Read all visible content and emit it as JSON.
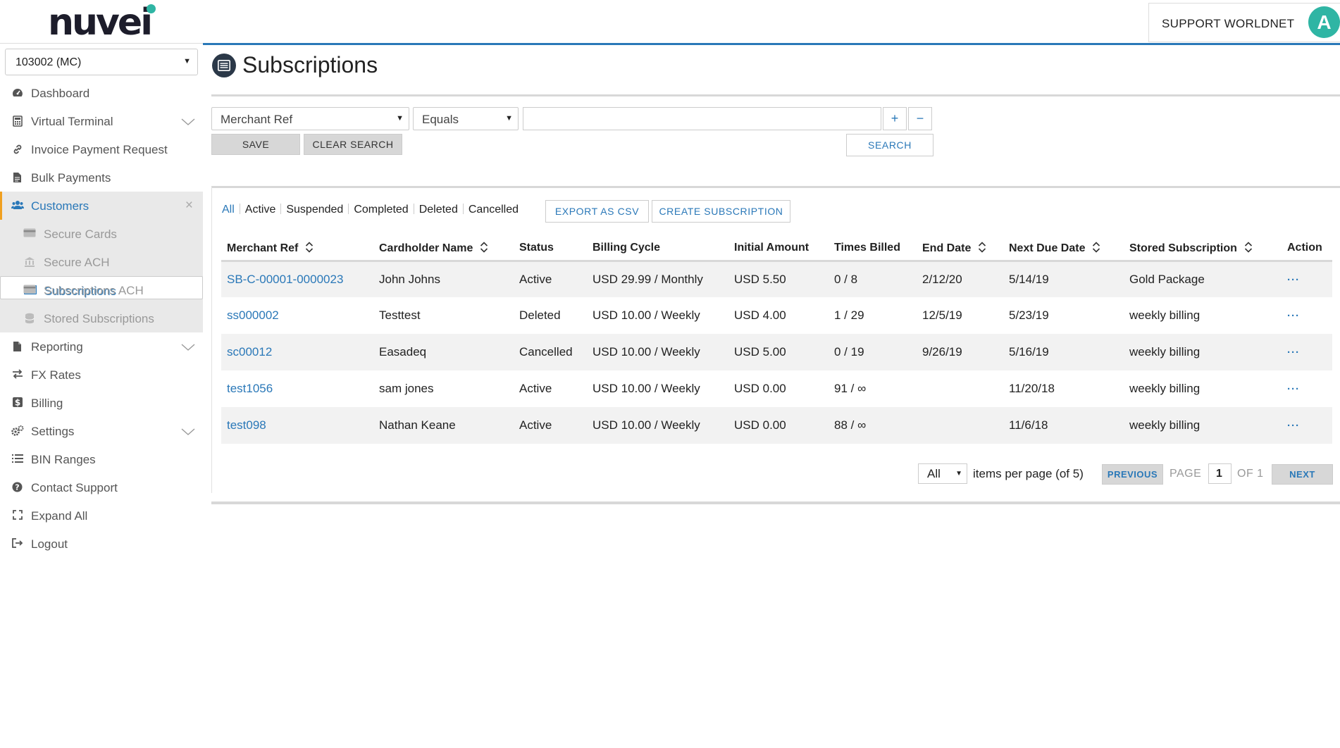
{
  "brand": {
    "logo_text": "nuvei",
    "accent": "#2fb5a4",
    "primary": "#2a78b8"
  },
  "user": {
    "name": "SUPPORT WORLDNET",
    "initial": "A"
  },
  "account_select": {
    "value": "103002 (MC)"
  },
  "sidebar": {
    "items": [
      {
        "label": "Dashboard",
        "icon": "gauge-icon"
      },
      {
        "label": "Virtual Terminal",
        "icon": "calculator-icon"
      },
      {
        "label": "Invoice Payment Request",
        "icon": "link-icon"
      },
      {
        "label": "Bulk Payments",
        "icon": "document-icon"
      },
      {
        "label": "Customers",
        "icon": "users-icon"
      },
      {
        "label": "Reporting",
        "icon": "file-icon"
      },
      {
        "label": "FX Rates",
        "icon": "exchange-icon"
      },
      {
        "label": "Billing",
        "icon": "dollar-icon"
      },
      {
        "label": "Settings",
        "icon": "gears-icon"
      },
      {
        "label": "BIN Ranges",
        "icon": "list-icon"
      },
      {
        "label": "Contact Support",
        "icon": "question-icon"
      },
      {
        "label": "Expand All",
        "icon": "expand-icon"
      },
      {
        "label": "Logout",
        "icon": "logout-icon"
      }
    ],
    "customers_sub": [
      {
        "label": "Secure Cards",
        "icon": "card-icon"
      },
      {
        "label": "Secure ACH",
        "icon": "bank-icon"
      },
      {
        "label": "Subscriptions",
        "icon": "subscriptions-icon"
      },
      {
        "label": "Subscriptions ACH",
        "icon": "card-icon"
      },
      {
        "label": "Stored Subscriptions",
        "icon": "database-icon"
      }
    ]
  },
  "page": {
    "title": "Subscriptions"
  },
  "filter": {
    "field": "Merchant Ref",
    "operator": "Equals",
    "value": "",
    "add": "+",
    "remove": "−",
    "save": "SAVE",
    "clear": "CLEAR SEARCH",
    "search": "SEARCH"
  },
  "status_tabs": [
    "All",
    "Active",
    "Suspended",
    "Completed",
    "Deleted",
    "Cancelled"
  ],
  "actions": {
    "export": "EXPORT AS CSV",
    "create": "CREATE SUBSCRIPTION"
  },
  "table": {
    "headers": [
      "Merchant Ref",
      "Cardholder Name",
      "Status",
      "Billing Cycle",
      "Initial Amount",
      "Times Billed",
      "End Date",
      "Next Due Date",
      "Stored Subscription",
      "Action"
    ],
    "rows": [
      [
        "SB-C-00001-0000023",
        "John Johns",
        "Active",
        "USD 29.99 / Monthly",
        "USD 5.50",
        "0 / 8",
        "2/12/20",
        "5/14/19",
        "Gold Package",
        "···"
      ],
      [
        "ss000002",
        "Testtest",
        "Deleted",
        "USD 10.00 / Weekly",
        "USD 4.00",
        "1 / 29",
        "12/5/19",
        "5/23/19",
        "weekly billing",
        "···"
      ],
      [
        "sc00012",
        "Easadeq",
        "Cancelled",
        "USD 10.00 / Weekly",
        "USD 5.00",
        "0 / 19",
        "9/26/19",
        "5/16/19",
        "weekly billing",
        "···"
      ],
      [
        "test1056",
        "sam jones",
        "Active",
        "USD 10.00 / Weekly",
        "USD 0.00",
        "91 / ∞",
        "",
        "11/20/18",
        "weekly billing",
        "···"
      ],
      [
        "test098",
        "Nathan Keane",
        "Active",
        "USD 10.00 / Weekly",
        "USD 0.00",
        "88 / ∞",
        "",
        "11/6/18",
        "weekly billing",
        "···"
      ]
    ]
  },
  "pagination": {
    "per_page": "All",
    "per_page_label": "items per page (of 5)",
    "previous": "PREVIOUS",
    "page_label": "PAGE",
    "page": "1",
    "of_label": "OF 1",
    "next": "NEXT"
  }
}
